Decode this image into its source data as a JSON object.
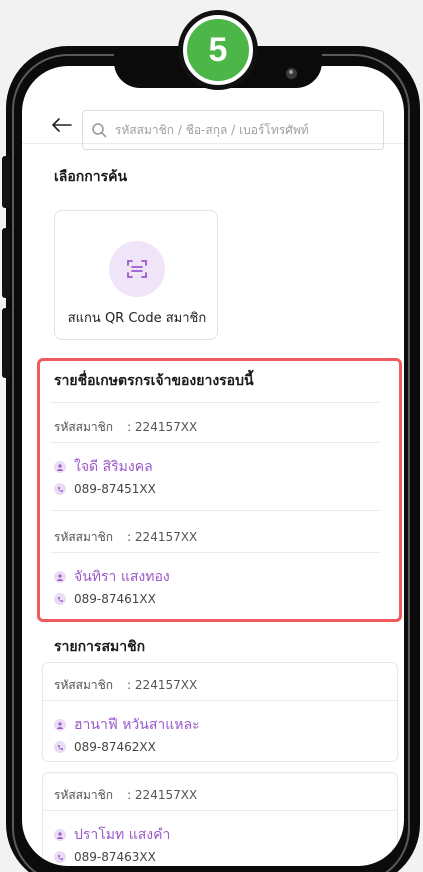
{
  "step": {
    "number": "5"
  },
  "search": {
    "placeholder": "รหัสสมาชิก / ชื่อ-สกุล / เบอร์โทรศัพท์"
  },
  "options": {
    "title": "เลือกการค้น",
    "scan_label": "สแกน QR Code สมาชิก"
  },
  "owners": {
    "title": "รายชื่อเกษตรกรเจ้าของยางรอบนี้",
    "items": [
      {
        "id_label": "รหัสสมาชิก",
        "id_value": ": 224157XX",
        "name": "ใจดี สิริมงคล",
        "phone": "089-87451XX"
      },
      {
        "id_label": "รหัสสมาชิก",
        "id_value": ": 224157XX",
        "name": "จันทิรา แสงทอง",
        "phone": "089-87461XX"
      }
    ]
  },
  "members": {
    "title": "รายการสมาชิก",
    "items": [
      {
        "id_label": "รหัสสมาชิก",
        "id_value": ": 224157XX",
        "name": "ฮานาฟี  หวันสาแหละ",
        "phone": "089-87462XX"
      },
      {
        "id_label": "รหัสสมาชิก",
        "id_value": ": 224157XX",
        "name": "ปราโมท  แสงคำ",
        "phone": "089-87463XX"
      }
    ]
  },
  "colors": {
    "accent": "#9b59c9",
    "highlight": "#ef5a5e",
    "badge": "#4cb648"
  }
}
